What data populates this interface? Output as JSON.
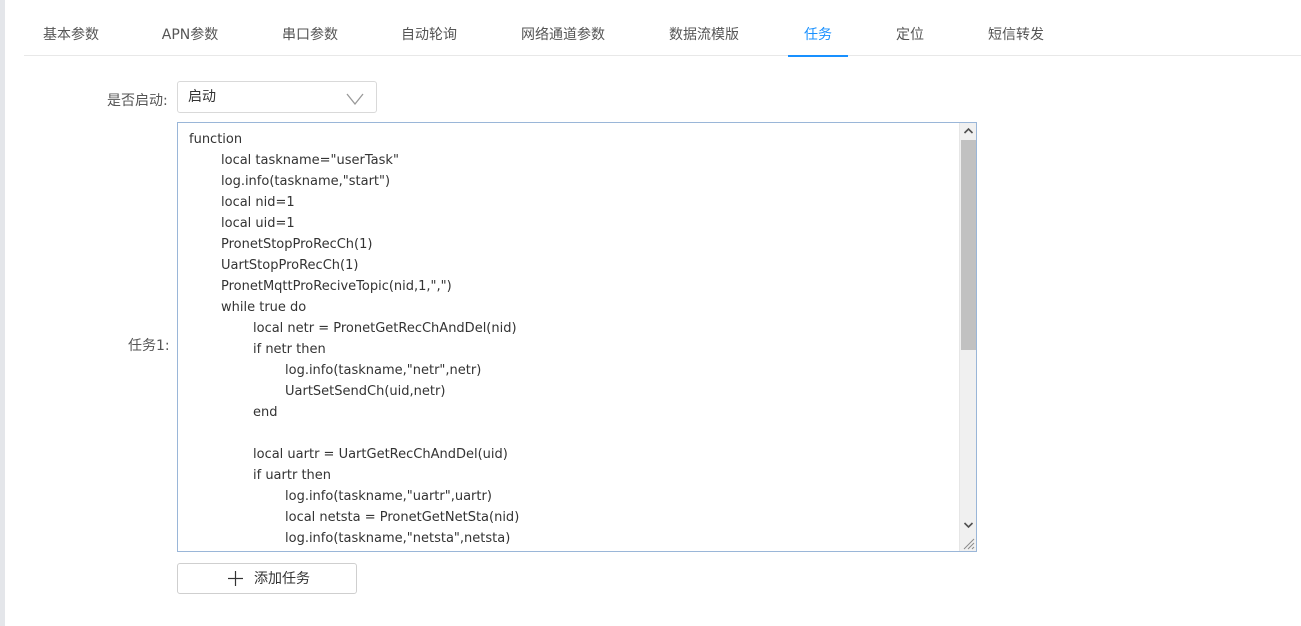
{
  "tabs": [
    {
      "label": "基本参数",
      "active": false
    },
    {
      "label": "APN参数",
      "active": false
    },
    {
      "label": "串口参数",
      "active": false
    },
    {
      "label": "自动轮询",
      "active": false
    },
    {
      "label": "网络通道参数",
      "active": false
    },
    {
      "label": "数据流模版",
      "active": false
    },
    {
      "label": "任务",
      "active": true
    },
    {
      "label": "定位",
      "active": false
    },
    {
      "label": "短信转发",
      "active": false
    }
  ],
  "form": {
    "enable_label": "是否启动:",
    "enable_value": "启动",
    "task_label": "任务1:",
    "add_task_label": "添加任务"
  },
  "editor": {
    "lines": [
      "function",
      "\tlocal taskname=\"userTask\"",
      "\tlog.info(taskname,\"start\")",
      "\tlocal nid=1",
      "\tlocal uid=1",
      "\tPronetStopProRecCh(1)",
      "\tUartStopProRecCh(1)",
      "\tPronetMqttProReciveTopic(nid,1,\",\")",
      "\twhile true do",
      "\t\tlocal netr = PronetGetRecChAndDel(nid)",
      "\t\tif netr then",
      "\t\t\tlog.info(taskname,\"netr\",netr)",
      "\t\t\tUartSetSendCh(uid,netr)",
      "\t\tend",
      "",
      "\t\tlocal uartr = UartGetRecChAndDel(uid)",
      "\t\tif uartr then",
      "\t\t\tlog.info(taskname,\"uartr\",uartr)",
      "\t\t\tlocal netsta = PronetGetNetSta(nid)",
      "\t\t\tlog.info(taskname,\"netsta\",netsta)"
    ]
  },
  "colors": {
    "accent": "#1890ff",
    "border": "#d9d9d9",
    "editor_border": "#9ab6d8"
  },
  "icons": {
    "select_arrow": "chevron-down-icon",
    "add": "plus-icon",
    "scroll_up": "arrow-up-icon",
    "scroll_down": "arrow-down-icon",
    "resize": "resize-grip-icon"
  }
}
